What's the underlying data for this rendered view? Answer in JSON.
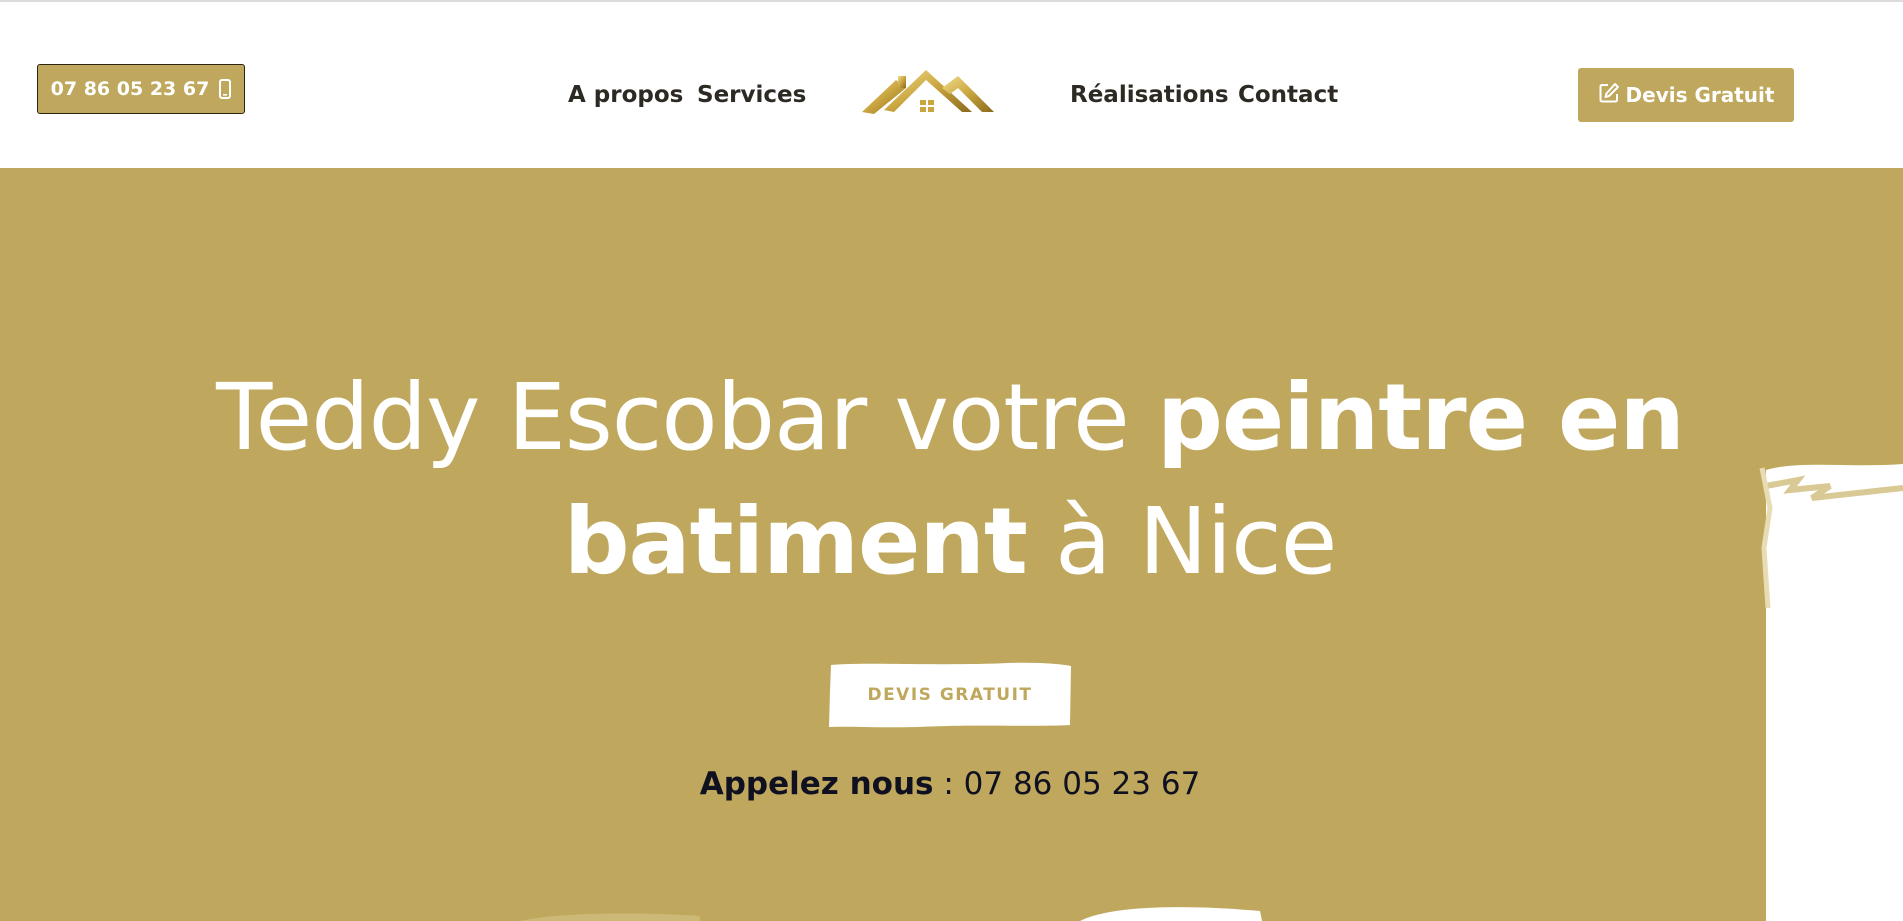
{
  "header": {
    "phone_button_label": "07 86 05 23 67",
    "nav": {
      "about": "A propos",
      "services": "Services",
      "realisations": "Réalisations",
      "contact": "Contact"
    },
    "cta_label": "Devis Gratuit",
    "icons": {
      "phone": "mobile-phone-icon",
      "cta": "edit-icon",
      "logo": "roof-logo-icon"
    }
  },
  "hero": {
    "title_part1": "Teddy Escobar votre ",
    "title_bold1": "peintre en batiment",
    "title_part2": " à Nice",
    "button_label": "DEVIS GRATUIT",
    "call_label": "Appelez nous",
    "call_separator": " : ",
    "call_number": "07 86 05 23 67"
  },
  "colors": {
    "accent": "#bfa85d",
    "white": "#ffffff",
    "nav_text": "#2d2a24",
    "call_text": "#0f1020"
  }
}
